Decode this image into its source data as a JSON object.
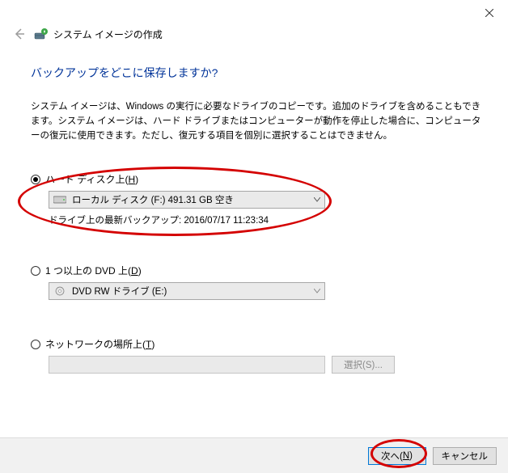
{
  "window": {
    "wizard_title": "システム イメージの作成"
  },
  "page": {
    "heading": "バックアップをどこに保存しますか?",
    "description": "システム イメージは、Windows の実行に必要なドライブのコピーです。追加のドライブを含めることもできます。システム イメージは、ハード ドライブまたはコンピューターが動作を停止した場合に、コンピューターの復元に使用できます。ただし、復元する項目を個別に選択することはできません。"
  },
  "options": {
    "hdd": {
      "label_prefix": "ハード ディスク上(",
      "hotkey": "H",
      "label_suffix": ")",
      "selected": true,
      "dropdown_value": "ローカル ディスク (F:)  491.31 GB 空き",
      "last_backup_label": "ドライブ上の最新バックアップ:",
      "last_backup_value": "2016/07/17 11:23:34"
    },
    "dvd": {
      "label_prefix": "1 つ以上の DVD 上(",
      "hotkey": "D",
      "label_suffix": ")",
      "selected": false,
      "dropdown_value": "DVD RW ドライブ (E:)"
    },
    "network": {
      "label_prefix": "ネットワークの場所上(",
      "hotkey": "T",
      "label_suffix": ")",
      "selected": false,
      "path_value": "",
      "browse_label": "選択(S)..."
    }
  },
  "footer": {
    "next_prefix": "次へ(",
    "next_hotkey": "N",
    "next_suffix": ")",
    "cancel": "キャンセル"
  }
}
